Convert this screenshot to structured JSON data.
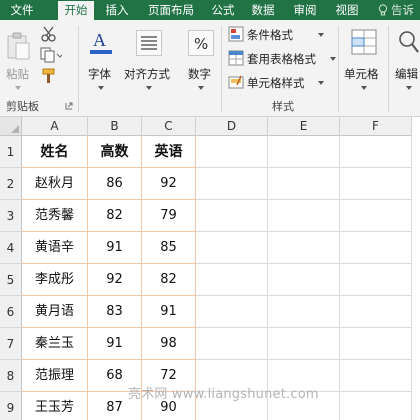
{
  "tabs": [
    {
      "label": "文件"
    },
    {
      "label": "开始"
    },
    {
      "label": "插入"
    },
    {
      "label": "页面布局"
    },
    {
      "label": "公式"
    },
    {
      "label": "数据"
    },
    {
      "label": "审阅"
    },
    {
      "label": "视图"
    }
  ],
  "help_label": "告诉",
  "ribbon": {
    "clipboard": {
      "paste_label": "粘贴",
      "group_label": "剪贴板"
    },
    "font_label": "字体",
    "alignment_label": "对齐方式",
    "number_label": "数字",
    "styles": {
      "conditional_format": "条件格式",
      "table_format": "套用表格格式",
      "cell_styles": "单元格样式",
      "group_label": "样式"
    },
    "cells_label": "单元格",
    "editing_label": "编辑"
  },
  "sheet": {
    "columns": [
      "A",
      "B",
      "C",
      "D",
      "E",
      "F"
    ],
    "rows": [
      "1",
      "2",
      "3",
      "4",
      "5",
      "6",
      "7",
      "8",
      "9"
    ],
    "headers": [
      "姓名",
      "高数",
      "英语"
    ],
    "records": [
      [
        "赵秋月",
        "86",
        "92"
      ],
      [
        "范秀馨",
        "82",
        "79"
      ],
      [
        "黄语辛",
        "91",
        "85"
      ],
      [
        "李成彤",
        "92",
        "82"
      ],
      [
        "黄月语",
        "83",
        "91"
      ],
      [
        "秦兰玉",
        "91",
        "98"
      ],
      [
        "范振理",
        "68",
        "72"
      ],
      [
        "王玉芳",
        "87",
        "90"
      ]
    ]
  },
  "watermark": "亮术网 www.liangshunet.com",
  "colors": {
    "excel_green": "#217346",
    "cell_border_accent": "#f5c7a6"
  }
}
